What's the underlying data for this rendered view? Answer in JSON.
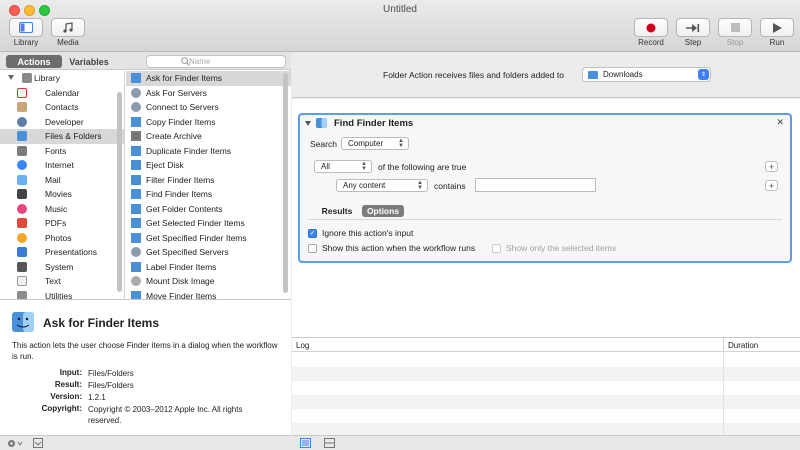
{
  "window": {
    "title": "Untitled"
  },
  "toolbar": {
    "library_label": "Library",
    "media_label": "Media",
    "record_label": "Record",
    "step_label": "Step",
    "stop_label": "Stop",
    "run_label": "Run"
  },
  "left": {
    "tabs": {
      "actions": "Actions",
      "variables": "Variables"
    },
    "search_placeholder": "Name",
    "library": {
      "root": "Library",
      "items": [
        "Calendar",
        "Contacts",
        "Developer",
        "Files & Folders",
        "Fonts",
        "Internet",
        "Mail",
        "Movies",
        "Music",
        "PDFs",
        "Photos",
        "Presentations",
        "System",
        "Text",
        "Utilities"
      ],
      "selected": "Files & Folders"
    },
    "actions": {
      "items": [
        "Ask for Finder Items",
        "Ask For Servers",
        "Connect to Servers",
        "Copy Finder Items",
        "Create Archive",
        "Duplicate Finder Items",
        "Eject Disk",
        "Filter Finder Items",
        "Find Finder Items",
        "Get Folder Contents",
        "Get Selected Finder Items",
        "Get Specified Finder Items",
        "Get Specified Servers",
        "Label Finder Items",
        "Mount Disk Image",
        "Move Finder Items"
      ],
      "selected": "Ask for Finder Items"
    },
    "description": {
      "title": "Ask for Finder Items",
      "text": "This action lets the user choose Finder items in a dialog when the workflow is run.",
      "input_key": "Input:",
      "input_val": "Files/Folders",
      "result_key": "Result:",
      "result_val": "Files/Folders",
      "version_key": "Version:",
      "version_val": "1.2.1",
      "copyright_key": "Copyright:",
      "copyright_val": "Copyright © 2003–2012 Apple Inc.  All rights reserved."
    }
  },
  "workflow": {
    "receives_label": "Folder Action receives files and folders added to",
    "receives_folder": "Downloads",
    "action": {
      "title": "Find Finder Items",
      "search_label": "Search",
      "search_value": "Computer",
      "match_value": "All",
      "match_suffix": "of the following are true",
      "criteria_field": "Any content",
      "criteria_op": "contains",
      "criteria_text": "",
      "tab_results": "Results",
      "tab_options": "Options",
      "ignore_input": "Ignore this action's input",
      "ignore_input_checked": true,
      "show_action": "Show this action when the workflow runs",
      "show_action_checked": false,
      "show_selected": "Show only the selected items",
      "show_selected_checked": false
    }
  },
  "log": {
    "col_log": "Log",
    "col_duration": "Duration"
  },
  "colors": {
    "accent": "#3b86f7",
    "selection": "#d8d8d8",
    "record": "#d0021b"
  }
}
